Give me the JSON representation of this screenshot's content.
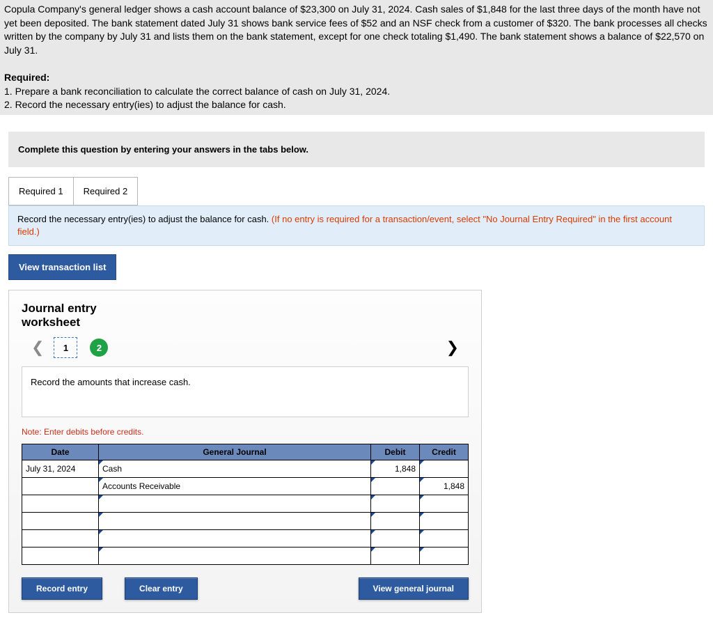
{
  "problem": {
    "p1": "Copula Company's general ledger shows a cash account balance of $23,300 on July 31, 2024. Cash sales of $1,848 for the last three days of the month have not yet been deposited. The bank statement dated July 31 shows bank service fees of $52 and an NSF check from a customer of $320. The bank processes all checks written by the company by July 31 and lists them on the bank statement, except for one check totaling $1,490. The bank statement shows a balance of $22,570 on July 31.",
    "required_label": "Required:",
    "req1": "1. Prepare a bank reconciliation to calculate the correct balance of cash on July 31, 2024.",
    "req2": "2. Record the necessary entry(ies) to adjust the balance for cash."
  },
  "complete_prompt": "Complete this question by entering your answers in the tabs below.",
  "tabs": {
    "t1": "Required 1",
    "t2": "Required 2"
  },
  "instruction": {
    "black": "Record the necessary entry(ies) to adjust the balance for cash. ",
    "red": "(If no entry is required for a transaction/event, select \"No Journal Entry Required\" in the first account field.)"
  },
  "buttons": {
    "view_list": "View transaction list",
    "record": "Record entry",
    "clear": "Clear entry",
    "view_journal": "View general journal"
  },
  "worksheet": {
    "title_l1": "Journal entry",
    "title_l2": "worksheet",
    "pager": {
      "p1": "1",
      "p2": "2"
    },
    "prompt": "Record the amounts that increase cash.",
    "note": "Note: Enter debits before credits.",
    "headers": {
      "date": "Date",
      "gj": "General Journal",
      "debit": "Debit",
      "credit": "Credit"
    },
    "rows": [
      {
        "date": "July 31, 2024",
        "account": "Cash",
        "debit": "1,848",
        "credit": ""
      },
      {
        "date": "",
        "account": "Accounts Receivable",
        "debit": "",
        "credit": "1,848"
      },
      {
        "date": "",
        "account": "",
        "debit": "",
        "credit": ""
      },
      {
        "date": "",
        "account": "",
        "debit": "",
        "credit": ""
      },
      {
        "date": "",
        "account": "",
        "debit": "",
        "credit": ""
      },
      {
        "date": "",
        "account": "",
        "debit": "",
        "credit": ""
      }
    ]
  }
}
